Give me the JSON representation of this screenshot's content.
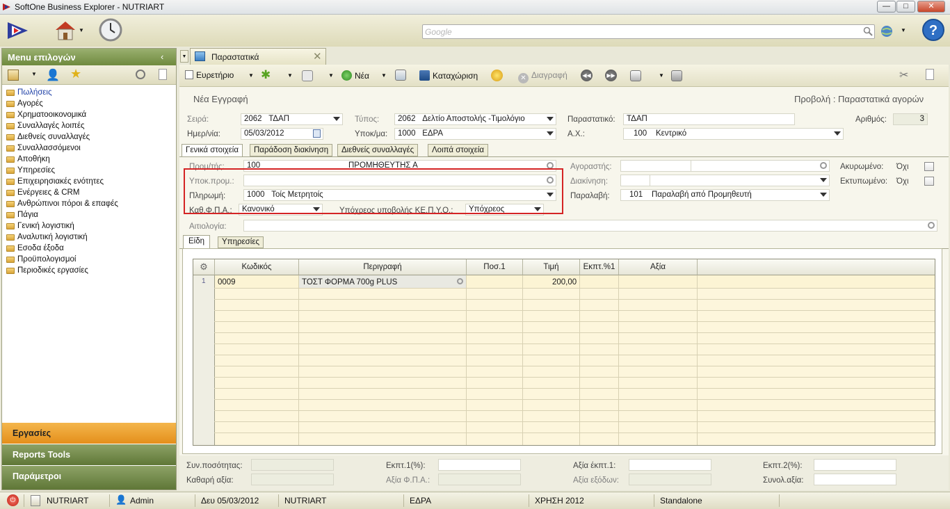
{
  "window": {
    "title": "SoftOne Business Explorer - NUTRIART",
    "min": "—",
    "max": "□",
    "close": "✕"
  },
  "search": {
    "placeholder": "Google"
  },
  "left_panel": {
    "title": "Menu επιλογών",
    "items": [
      "Πωλήσεις",
      "Αγορές",
      "Χρηματοοικονομικά",
      "Συναλλαγές λοιπές",
      "Διεθνείς συναλλαγές",
      "Συναλλασσόμενοι",
      "Αποθήκη",
      "Υπηρεσίες",
      "Επιχειρησιακές ενότητες",
      "Ενέργειες & CRM",
      "Ανθρώπινοι πόροι & επαφές",
      "Πάγια",
      "Γενική λογιστική",
      "Αναλυτική λογιστική",
      "Εσοδα έξοδα",
      "Προϋπολογισμοί",
      "Περιοδικές εργασίες"
    ],
    "sections": [
      "Εργασίες",
      "Reports Tools",
      "Παράμετροι"
    ]
  },
  "doc_tab": {
    "label": "Παραστατικά"
  },
  "toolbar": {
    "index": "Ευρετήριο",
    "new": "Νέα",
    "save": "Καταχώριση",
    "delete": "Διαγραφή"
  },
  "form": {
    "header_left": "Νέα Εγγραφή",
    "header_right": "Προβολή : Παραστατικά αγορών",
    "series_label": "Σειρά:",
    "series_code": "2062",
    "series_name": "ΤΔΑΠ",
    "type_label": "Τύπος:",
    "type_code": "2062",
    "type_name": "Δελτίο Αποστολής -Τιμολόγιο",
    "doc_label": "Παραστατικό:",
    "doc_value": "ΤΔΑΠ",
    "number_label": "Αριθμός:",
    "number_value": "3",
    "date_label": "Ημερ/νία:",
    "date_value": "05/03/2012",
    "branch_label": "Υποκ/μα:",
    "branch_code": "1000",
    "branch_name": "ΕΔΡΑ",
    "wh_label": "Α.Χ.:",
    "wh_code": "100",
    "wh_name": "Κεντρικό",
    "tabs": [
      "Γενικά στοιχεία",
      "Παράδοση διακίνηση",
      "Διεθνείς συναλλαγές",
      "Λοιπά στοιχεία"
    ],
    "supplier_label": "Προμ/τής:",
    "supplier_code": "100",
    "supplier_name": "ΠΡΟΜΗΘΕΥΤΗΣ Α",
    "subsupplier_label": "Υποκ.προμ.:",
    "payment_label": "Πληρωμή:",
    "payment_code": "1000",
    "payment_name": "Τοίς Μετρητοίς",
    "vat_label": "Καθ.Φ.Π.Α.:",
    "vat_value": "Κανονικό",
    "kepyo_label": "Υπόχρεος υποβολής ΚΕ.Π.Υ.Ο.:",
    "kepyo_value": "Υπόχρεος",
    "buyer_label": "Αγοραστής:",
    "shipping_label": "Διακίνηση:",
    "receipt_label": "Παραλαβή:",
    "receipt_code": "101",
    "receipt_name": "Παραλαβή από Προμηθευτή",
    "cancelled_label": "Ακυρωμένο:",
    "cancelled_value": "Όχι",
    "printed_label": "Εκτυπωμένο:",
    "printed_value": "Όχι",
    "reason_label": "Αιτιολογία:",
    "sub_tabs": [
      "Είδη",
      "Υπηρεσίες"
    ]
  },
  "grid": {
    "headers": [
      "Κωδικός",
      "Περιγραφή",
      "Ποσ.1",
      "Τιμή",
      "Εκπτ.%1",
      "Αξία"
    ],
    "rows": [
      {
        "num": "1",
        "code": "0009",
        "desc": "ΤΟΣΤ ΦΟΡΜΑ 700g PLUS",
        "price": "200,00"
      }
    ]
  },
  "totals": {
    "qty_label": "Συν.ποσότητας:",
    "net_label": "Καθαρή αξία:",
    "disc1_label": "Εκπτ.1(%):",
    "vat_label": "Αξία Φ.Π.Α.:",
    "disc1_val_label": "Αξία έκπτ.1:",
    "expenses_label": "Αξία εξόδων:",
    "disc2_label": "Εκπτ.2(%):",
    "total_label": "Συνολ.αξία:"
  },
  "statusbar": {
    "company": "NUTRIART",
    "user": "Admin",
    "date": "Δευ 05/03/2012",
    "company2": "NUTRIART",
    "branch": "ΕΔΡΑ",
    "year": "ΧΡΗΣΗ 2012",
    "mode": "Standalone"
  }
}
